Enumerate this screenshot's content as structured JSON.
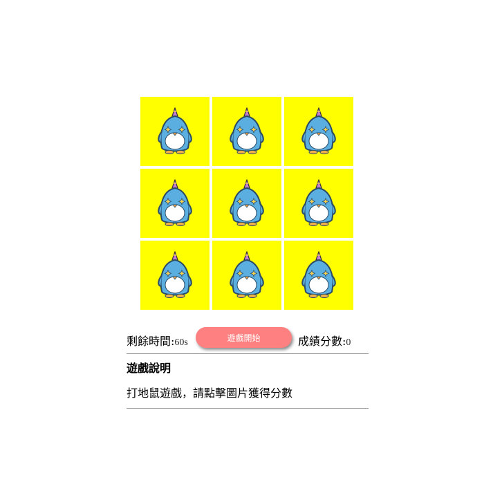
{
  "game": {
    "tiles": [
      {
        "icon": "penguin-icon"
      },
      {
        "icon": "penguin-icon"
      },
      {
        "icon": "penguin-icon"
      },
      {
        "icon": "penguin-icon"
      },
      {
        "icon": "penguin-icon"
      },
      {
        "icon": "penguin-icon"
      },
      {
        "icon": "penguin-icon"
      },
      {
        "icon": "penguin-icon"
      },
      {
        "icon": "penguin-icon"
      }
    ],
    "tile_color": "#ffff00"
  },
  "status": {
    "time_label": "剩餘時間:",
    "time_value": "60s",
    "start_label": "遊戲開始",
    "score_label": "成績分數:",
    "score_value": "0",
    "button_color": "#ff8080"
  },
  "instructions": {
    "title": "遊戲說明",
    "text": "打地鼠遊戲，請點擊圖片獲得分數"
  }
}
